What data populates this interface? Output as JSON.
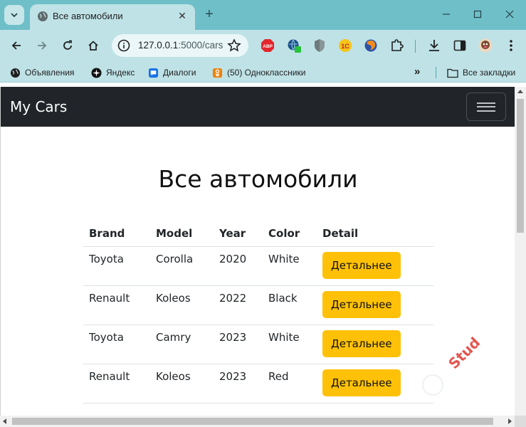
{
  "browser": {
    "tab": {
      "title": "Все автомобили"
    },
    "omnibox": {
      "url_host": "127.0.0.1",
      "url_path": ":5000/cars"
    },
    "extensions": [
      "adblock-icon",
      "translate-icon",
      "shield-icon",
      "onec-icon",
      "firefox-like-icon",
      "puzzle-icon"
    ],
    "bookmarks": [
      {
        "label": "Объявления",
        "icon": "globe-icon"
      },
      {
        "label": "Яндекс",
        "icon": "yandex-icon"
      },
      {
        "label": "Диалоги",
        "icon": "chat-icon"
      },
      {
        "label": "(50) Одноклассники",
        "icon": "ok-icon"
      }
    ],
    "all_bookmarks_label": "Все закладки",
    "colors": {
      "frame": "#6fbfc9",
      "toolbar": "#bfe2e6"
    }
  },
  "navbar": {
    "brand": "My Cars"
  },
  "main": {
    "title": "Все автомобили",
    "columns": [
      "Brand",
      "Model",
      "Year",
      "Color",
      "Detail"
    ],
    "rows": [
      {
        "brand": "Toyota",
        "model": "Corolla",
        "year": "2020",
        "color": "White",
        "action": "Детальнее"
      },
      {
        "brand": "Renault",
        "model": "Koleos",
        "year": "2022",
        "color": "Black",
        "action": "Детальнее"
      },
      {
        "brand": "Toyota",
        "model": "Camry",
        "year": "2023",
        "color": "White",
        "action": "Детальнее"
      },
      {
        "brand": "Renault",
        "model": "Koleos",
        "year": "2023",
        "color": "Red",
        "action": "Детальнее"
      }
    ]
  },
  "watermark": {
    "text": "Stud"
  },
  "colors": {
    "navbar": "#212529",
    "button": "#ffc107",
    "watermark": "#e0453f"
  }
}
